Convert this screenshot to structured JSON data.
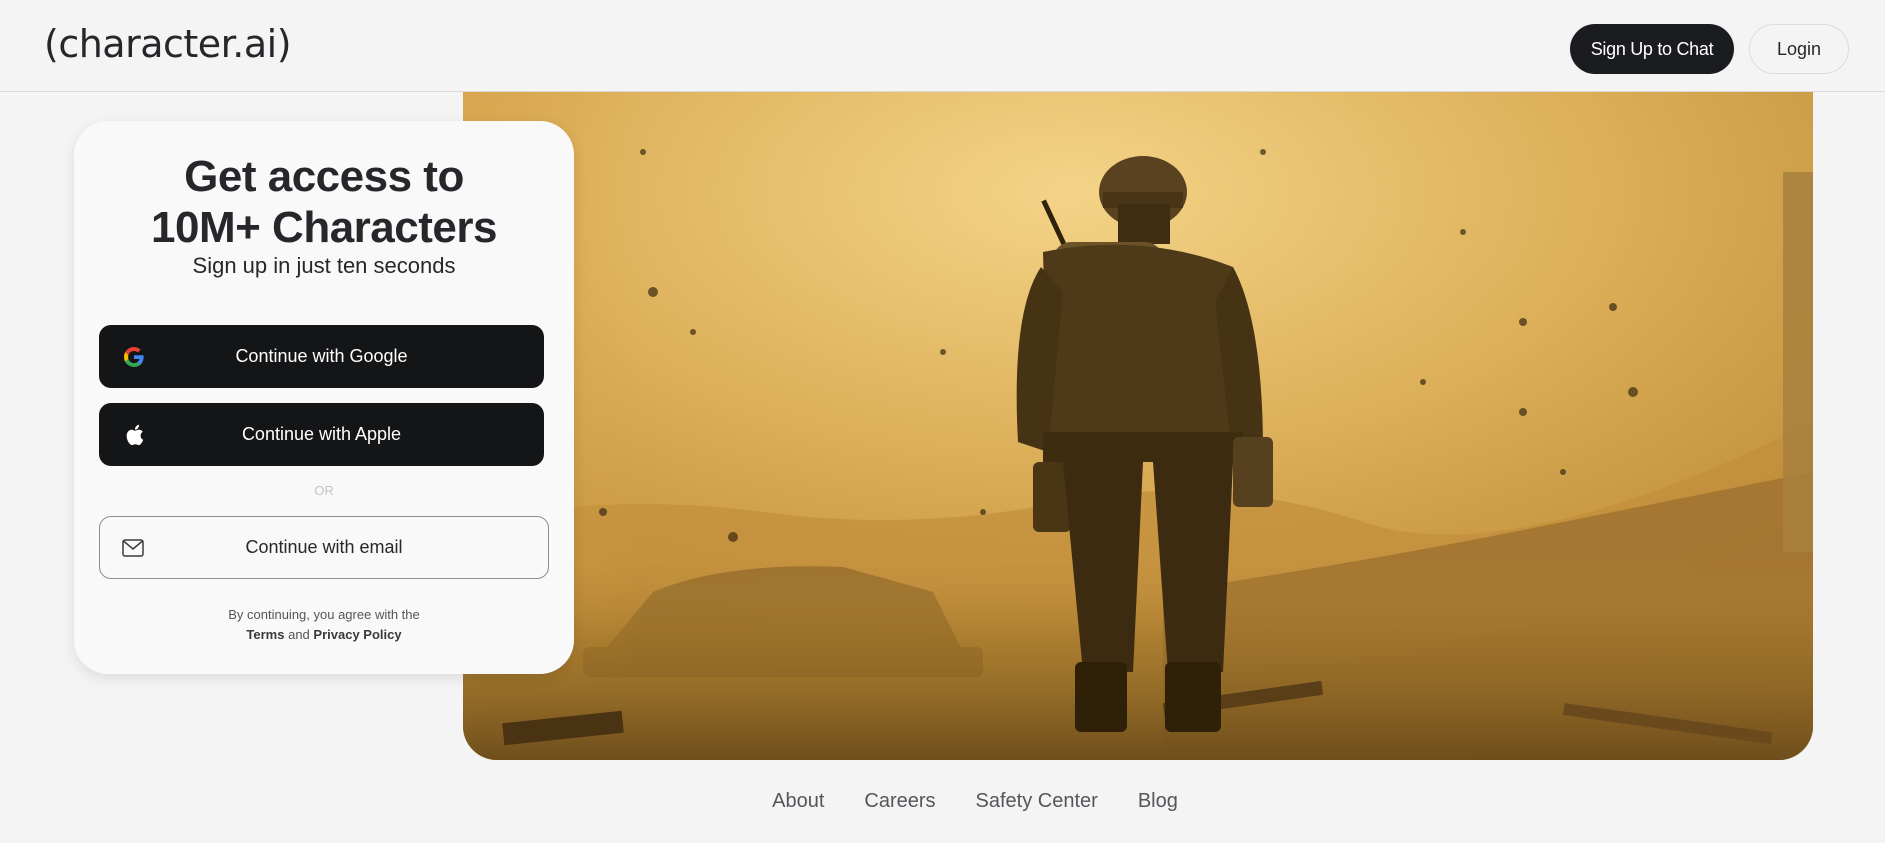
{
  "header": {
    "logo": "(character.ai)",
    "signup_label": "Sign Up to Chat",
    "login_label": "Login"
  },
  "card": {
    "title_line1": "Get access to",
    "title_line2": "10M+ Characters",
    "subtitle": "Sign up in just ten seconds",
    "google_label": "Continue with Google",
    "apple_label": "Continue with Apple",
    "or_label": "OR",
    "email_label": "Continue with email",
    "legal_prefix": "By continuing, you agree with the",
    "terms_label": "Terms",
    "and_label": "and",
    "privacy_label": "Privacy Policy"
  },
  "hero": {
    "icon": "soldier-in-dust-illustration"
  },
  "footer": {
    "links": [
      "About",
      "Careers",
      "Safety Center",
      "Blog"
    ]
  },
  "colors": {
    "primary_button": "#141517",
    "background": "#f4f4f4",
    "hero_tone": "#c9982f"
  }
}
